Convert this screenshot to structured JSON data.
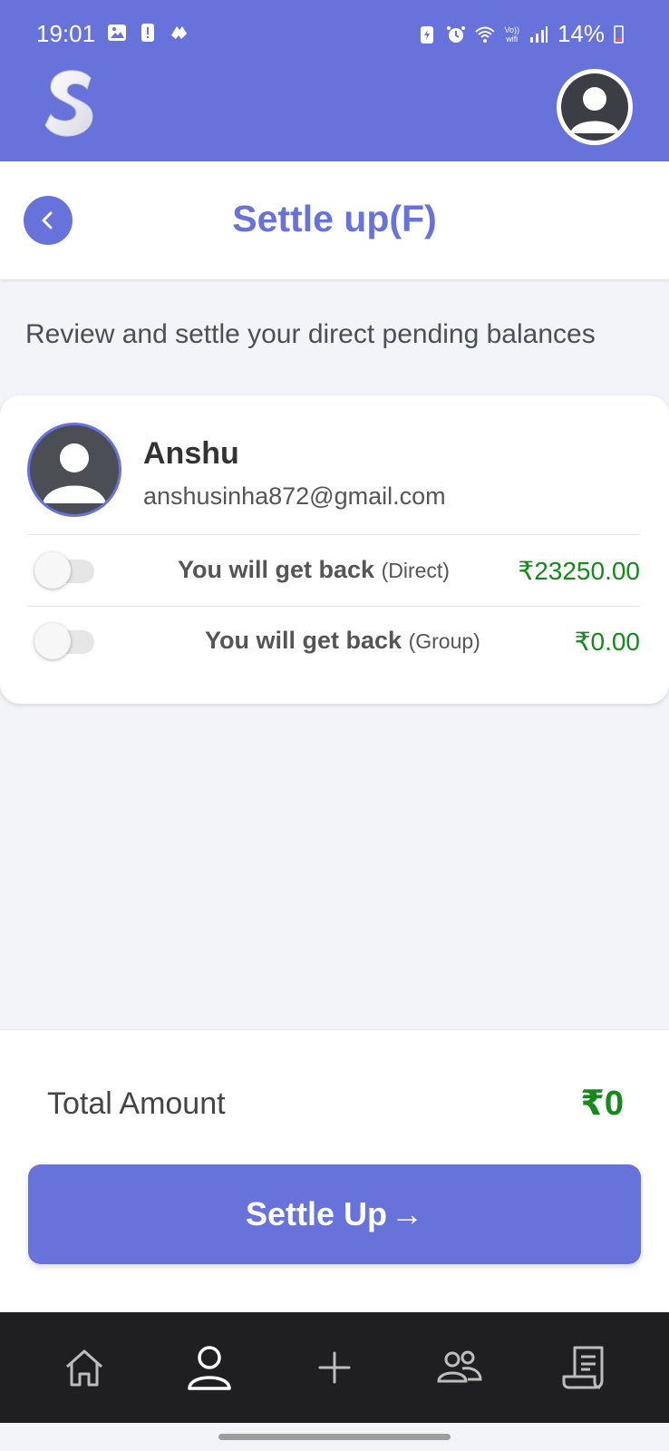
{
  "status_bar": {
    "time": "19:01",
    "battery": "14%",
    "network_label_top": "Vo))",
    "network_label_bottom": "wifi",
    "left_icons": [
      "gallery-icon",
      "alert-icon",
      "app-icon"
    ],
    "right_icons": [
      "battery-saver-icon",
      "alarm-icon",
      "wifi-icon",
      "signal-icon"
    ]
  },
  "header": {
    "logo_icon": "s-logo-icon",
    "profile_icon": "profile-icon"
  },
  "page": {
    "title": "Settle up(F)",
    "back_icon": "chevron-left-icon",
    "subtitle": "Review and settle your direct pending balances"
  },
  "friend": {
    "name": "Anshu",
    "email": "anshusinha872@gmail.com",
    "rows": [
      {
        "label": "You will get back",
        "sub": "(Direct)",
        "amount": "₹23250.00",
        "enabled": false
      },
      {
        "label": "You will get back",
        "sub": "(Group)",
        "amount": "₹0.00",
        "enabled": false
      }
    ]
  },
  "footer": {
    "total_label": "Total Amount",
    "total_value": "₹0",
    "settle_label": "Settle Up",
    "settle_arrow": "→"
  },
  "bottom_nav": {
    "items": [
      "home-icon",
      "user-icon",
      "plus-icon",
      "group-icon",
      "receipt-icon"
    ],
    "active": "user-icon"
  },
  "colors": {
    "primary": "#6872db",
    "positive": "#138a1a",
    "nav_bg": "#1f1f21"
  }
}
